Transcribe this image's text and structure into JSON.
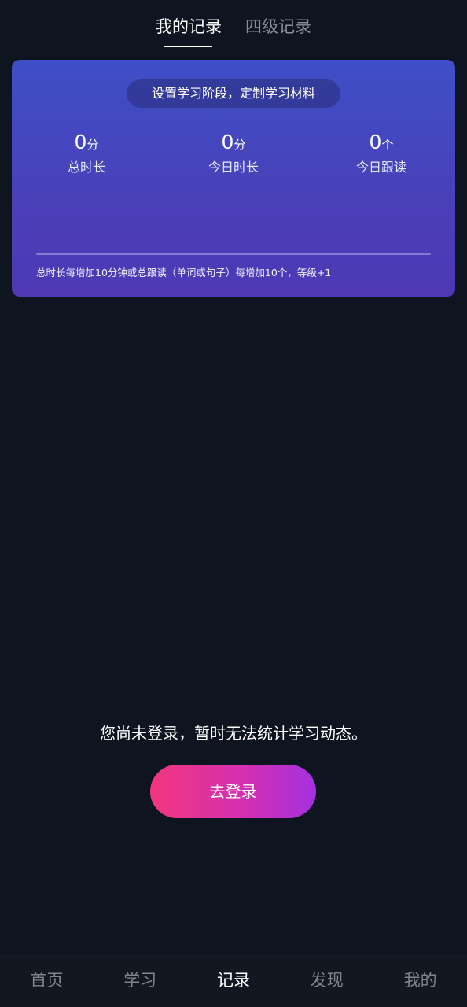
{
  "tabs": [
    {
      "label": "我的记录",
      "active": true
    },
    {
      "label": "四级记录",
      "active": false
    }
  ],
  "card": {
    "pill_label": "设置学习阶段，定制学习材料",
    "stats": [
      {
        "value": "0",
        "unit": "分",
        "label": "总时长"
      },
      {
        "value": "0",
        "unit": "分",
        "label": "今日时长"
      },
      {
        "value": "0",
        "unit": "个",
        "label": "今日跟读"
      }
    ],
    "progress_percent": 0,
    "hint": "总时长每增加10分钟或总跟读（单词或句子）每增加10个，等级+1"
  },
  "login": {
    "message": "您尚未登录，暂时无法统计学习动态。",
    "button_label": "去登录"
  },
  "bottom_nav": [
    {
      "label": "首页",
      "active": false
    },
    {
      "label": "学习",
      "active": false
    },
    {
      "label": "记录",
      "active": true
    },
    {
      "label": "发现",
      "active": false
    },
    {
      "label": "我的",
      "active": false
    }
  ],
  "colors": {
    "background": "#0e1520",
    "card_gradient_start": "#3e4fc7",
    "card_gradient_end": "#4e38b4",
    "button_gradient_start": "#f2377e",
    "button_gradient_end": "#a430e0",
    "inactive_text": "#7f858f"
  }
}
